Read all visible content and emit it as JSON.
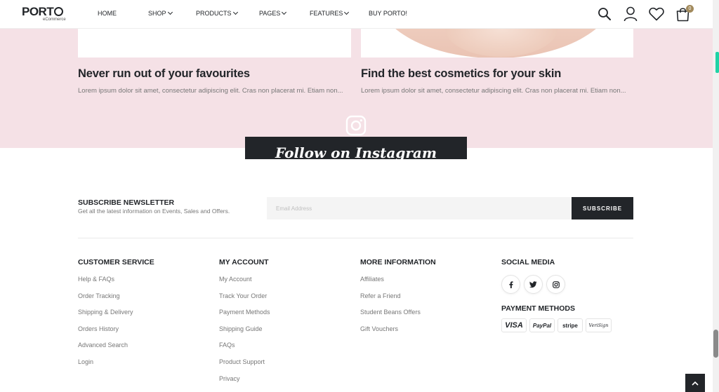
{
  "header": {
    "logo": "PORT",
    "logo_sub": "eCommerce",
    "nav": [
      "HOME",
      "SHOP",
      "PRODUCTS",
      "PAGES",
      "FEATURES",
      "BUY PORTO!"
    ],
    "cart_count": "0"
  },
  "blog": {
    "posts": [
      {
        "title": "Never run out of your favourites",
        "excerpt": "Lorem ipsum dolor sit amet, consectetur adipiscing elit. Cras non placerat mi. Etiam non..."
      },
      {
        "title": "Find the best cosmetics for your skin",
        "excerpt": "Lorem ipsum dolor sit amet, consectetur adipiscing elit. Cras non placerat mi. Etiam non..."
      }
    ]
  },
  "instagram": {
    "title": "Follow on Instagram"
  },
  "newsletter": {
    "title": "SUBSCRIBE NEWSLETTER",
    "subtitle": "Get all the latest information on Events, Sales and Offers.",
    "placeholder": "Email Address",
    "button": "SUBSCRIBE"
  },
  "footer": {
    "customer_service": {
      "title": "CUSTOMER SERVICE",
      "links": [
        "Help & FAQs",
        "Order Tracking",
        "Shipping & Delivery",
        "Orders History",
        "Advanced Search",
        "Login"
      ]
    },
    "my_account": {
      "title": "MY ACCOUNT",
      "links": [
        "My Account",
        "Track Your Order",
        "Payment Methods",
        "Shipping Guide",
        "FAQs",
        "Product Support",
        "Privacy"
      ]
    },
    "more_info": {
      "title": "MORE INFORMATION",
      "links": [
        "Affiliates",
        "Refer a Friend",
        "Student Beans Offers",
        "Gift Vouchers"
      ]
    },
    "social": {
      "title": "SOCIAL MEDIA",
      "icons": [
        "facebook-icon",
        "twitter-icon",
        "instagram-icon"
      ]
    },
    "payment": {
      "title": "PAYMENT METHODS",
      "methods": [
        "VISA",
        "PayPal",
        "stripe",
        "VeriSign"
      ]
    }
  },
  "colors": {
    "dark": "#222529",
    "pink_band": "#f5e1e6",
    "text_muted": "#777777",
    "badge": "#a28a5c"
  }
}
